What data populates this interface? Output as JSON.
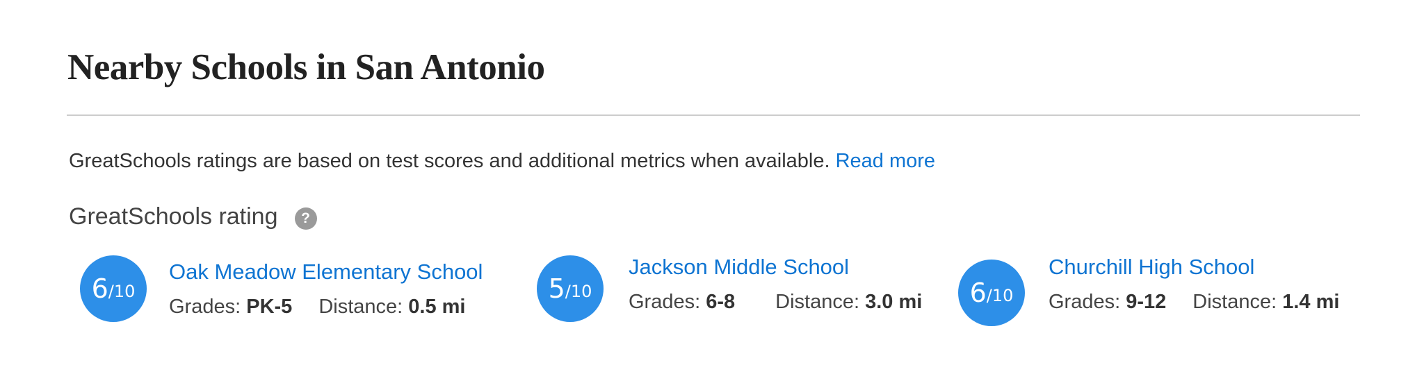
{
  "section": {
    "title": "Nearby Schools in San Antonio",
    "intro_text": "GreatSchools ratings are based on test scores and additional metrics when available.",
    "read_more_label": "Read more",
    "rating_heading": "GreatSchools rating",
    "help_icon_glyph": "?"
  },
  "labels": {
    "grades": "Grades:",
    "distance": "Distance:"
  },
  "schools": [
    {
      "name": "Oak Meadow Elementary School",
      "rating": "6",
      "rating_scale": "/10",
      "grades": "PK-5",
      "distance": "0.5 mi"
    },
    {
      "name": "Jackson Middle School",
      "rating": "5",
      "rating_scale": "/10",
      "grades": "6-8",
      "distance": "3.0 mi"
    },
    {
      "name": "Churchill High School",
      "rating": "6",
      "rating_scale": "/10",
      "grades": "9-12",
      "distance": "1.4 mi"
    }
  ],
  "colors": {
    "badge": "#2d8fe8",
    "link": "#0e74d2",
    "divider": "#cccccc",
    "help_icon": "#9a9a9a"
  },
  "icons": {
    "help": "question-circle-icon"
  }
}
